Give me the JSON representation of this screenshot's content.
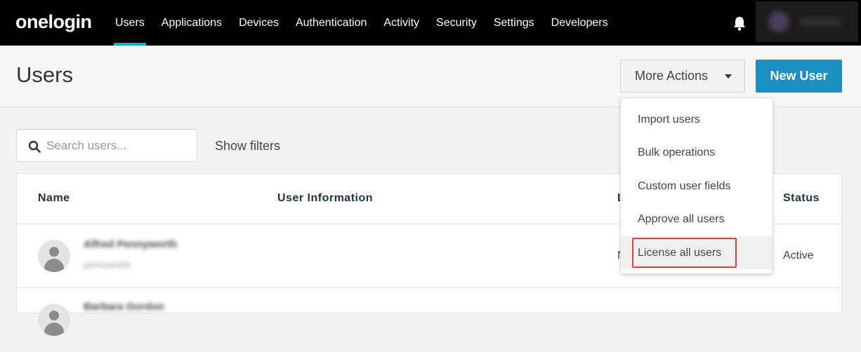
{
  "brand": {
    "logo_text": "onelogin"
  },
  "nav": {
    "items": [
      {
        "label": "Users",
        "active": true
      },
      {
        "label": "Applications"
      },
      {
        "label": "Devices"
      },
      {
        "label": "Authentication"
      },
      {
        "label": "Activity"
      },
      {
        "label": "Security"
      },
      {
        "label": "Settings"
      },
      {
        "label": "Developers"
      }
    ],
    "accent_color": "#1ba8d6",
    "icons": {
      "notifications": "bell-icon"
    }
  },
  "header": {
    "title": "Users",
    "more_actions_label": "More Actions",
    "new_user_label": "New User",
    "new_user_color": "#1b8fc2"
  },
  "search": {
    "placeholder": "Search users...",
    "value": "",
    "show_filters_label": "Show filters"
  },
  "table": {
    "columns": [
      "Name",
      "User Information",
      "L",
      "Status"
    ],
    "rows": [
      {
        "name": "Alfred Pennyworth",
        "username": "pennyworth",
        "partial_col": "N",
        "status": "Active"
      },
      {
        "name": "Barbara Gordon",
        "username": "",
        "partial_col": "",
        "status": ""
      }
    ]
  },
  "dropdown": {
    "items": [
      "Import users",
      "Bulk operations",
      "Custom user fields",
      "Approve all users",
      "License all users"
    ],
    "highlight_color": "#e0433f"
  }
}
